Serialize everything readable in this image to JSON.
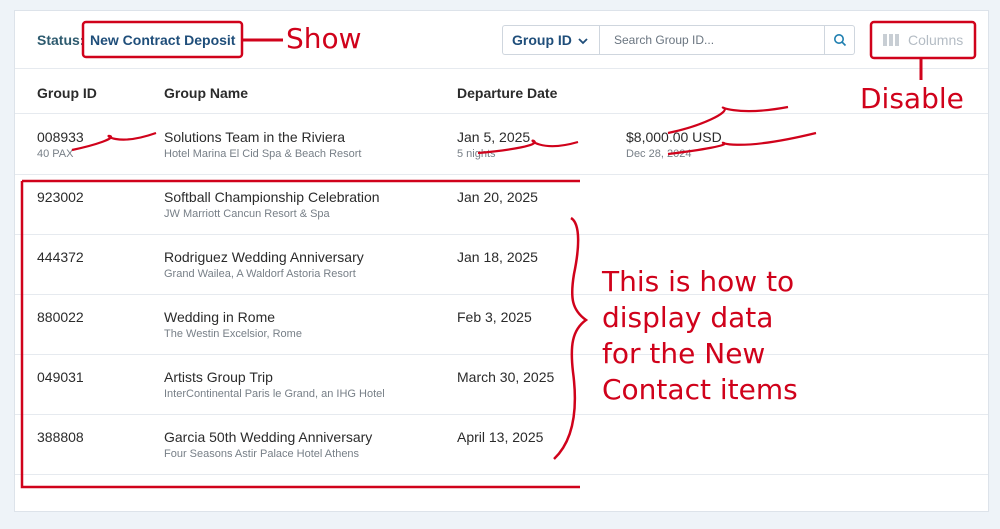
{
  "toolbar": {
    "status_label": "Status:",
    "status_value": "New Contract Deposit",
    "group_select": "Group ID",
    "search_placeholder": "Search Group ID...",
    "columns_label": "Columns"
  },
  "table": {
    "headers": [
      "Group ID",
      "Group Name",
      "Departure Date"
    ],
    "rows": [
      {
        "id": "008933",
        "pax": "40 PAX",
        "name": "Solutions Team in the Riviera",
        "hotel": "Hotel Marina El Cid Spa & Beach Resort",
        "date": "Jan 5, 2025",
        "nights": "5 nights",
        "amount": "$8,000.00 USD",
        "amount_date": "Dec 28, 2024"
      },
      {
        "id": "923002",
        "name": "Softball Championship Celebration",
        "hotel": "JW Marriott Cancun Resort & Spa",
        "date": "Jan 20, 2025"
      },
      {
        "id": "444372",
        "name": "Rodriguez Wedding Anniversary",
        "hotel": "Grand Wailea, A Waldorf Astoria Resort",
        "date": "Jan 18, 2025"
      },
      {
        "id": "880022",
        "name": "Wedding in Rome",
        "hotel": "The Westin Excelsior, Rome",
        "date": "Feb 3, 2025"
      },
      {
        "id": "049031",
        "name": "Artists Group Trip",
        "hotel": "InterContinental Paris le Grand, an IHG Hotel",
        "date": "March 30, 2025"
      },
      {
        "id": "388808",
        "name": "Garcia 50th Wedding Anniversary",
        "hotel": "Four Seasons Astir Palace Hotel Athens",
        "date": "April 13, 2025"
      }
    ]
  },
  "annotations": {
    "show": "Show",
    "disable": "Disable",
    "note_lines": [
      "This is how to",
      "display data",
      "for the New",
      "Contact items"
    ]
  },
  "colors": {
    "annotation": "#d0021b",
    "primary": "#1f4e7a",
    "muted": "#b4bcc4"
  }
}
